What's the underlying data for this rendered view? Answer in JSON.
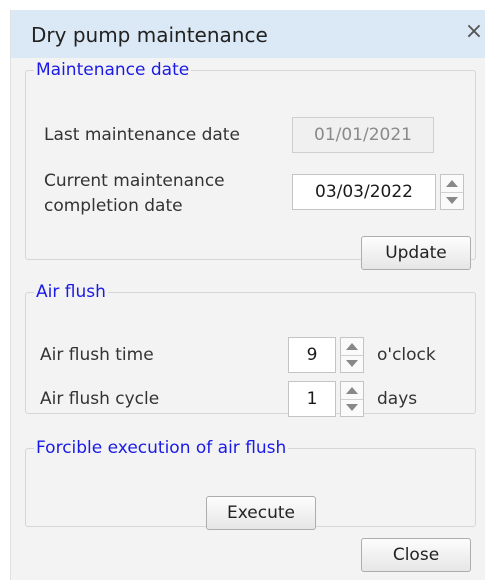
{
  "window": {
    "title": "Dry pump maintenance",
    "close_glyph": "×"
  },
  "maintenance_date": {
    "legend": "Maintenance date",
    "last_label": "Last maintenance date",
    "last_value": "01/01/2021",
    "current_label_line1": "Current maintenance",
    "current_label_line2": "completion date",
    "current_value": "03/03/2022",
    "update_label": "Update"
  },
  "air_flush": {
    "legend": "Air flush",
    "time_label": "Air flush time",
    "time_value": "9",
    "time_unit": "o'clock",
    "cycle_label": "Air flush cycle",
    "cycle_value": "1",
    "cycle_unit": "days"
  },
  "forcible": {
    "legend": "Forcible execution of air flush",
    "execute_label": "Execute"
  },
  "footer": {
    "close_label": "Close"
  },
  "colors": {
    "titlebar": "#dbe8f5",
    "legend_text": "#1a1ae6",
    "dialog_bg": "#f3f3f3"
  }
}
